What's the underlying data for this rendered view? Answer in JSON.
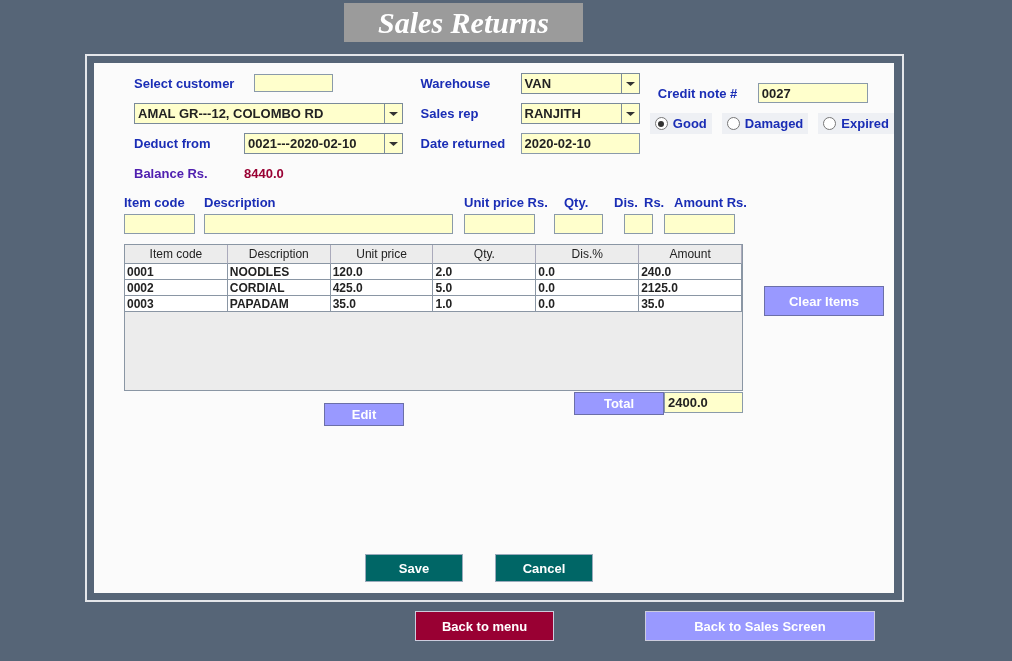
{
  "window": {
    "title": "Sales Returns"
  },
  "customer": {
    "search_label": "Select customer",
    "selected": "AMAL GR---12, COLOMBO RD",
    "deduct_label": "Deduct from",
    "deduct_value": "0021---2020-02-10",
    "balance_label": "Balance Rs.",
    "balance_value": "8440.0"
  },
  "details": [
    {
      "label": "Warehouse",
      "value": "VAN",
      "kind": "dropdown"
    },
    {
      "label": "Sales rep",
      "value": "RANJITH",
      "kind": "dropdown"
    },
    {
      "label": "Date returned",
      "value": "2020-02-10",
      "kind": "text"
    }
  ],
  "credit_note": {
    "label": "Credit note #",
    "value": "0027"
  },
  "conditions": [
    {
      "label": "Good",
      "selected": true
    },
    {
      "label": "Damaged",
      "selected": false
    },
    {
      "label": "Expired",
      "selected": false
    }
  ],
  "item_entry_labels": [
    "Item code",
    "Description",
    "Unit price Rs.",
    "Qty.",
    "Dis.",
    "Rs.",
    "Amount Rs."
  ],
  "table": {
    "columns": [
      "Item code",
      "Description",
      "Unit price",
      "Qty.",
      "Dis.%",
      "Amount"
    ],
    "rows": [
      [
        "0001",
        "NOODLES",
        "120.0",
        "2.0",
        "0.0",
        "240.0"
      ],
      [
        "0002",
        "CORDIAL",
        "425.0",
        "5.0",
        "0.0",
        "2125.0"
      ],
      [
        "0003",
        "PAPADAM",
        "35.0",
        "1.0",
        "0.0",
        "35.0"
      ]
    ]
  },
  "clear_button": "Clear Items",
  "edit_button": "Edit",
  "total": {
    "label": "Total",
    "value": "2400.0"
  },
  "form_buttons": [
    "Save",
    "Cancel"
  ],
  "nav_buttons": [
    {
      "label": "Back to menu",
      "kind": "dark"
    },
    {
      "label": "Back to Sales Screen",
      "kind": "light"
    }
  ]
}
